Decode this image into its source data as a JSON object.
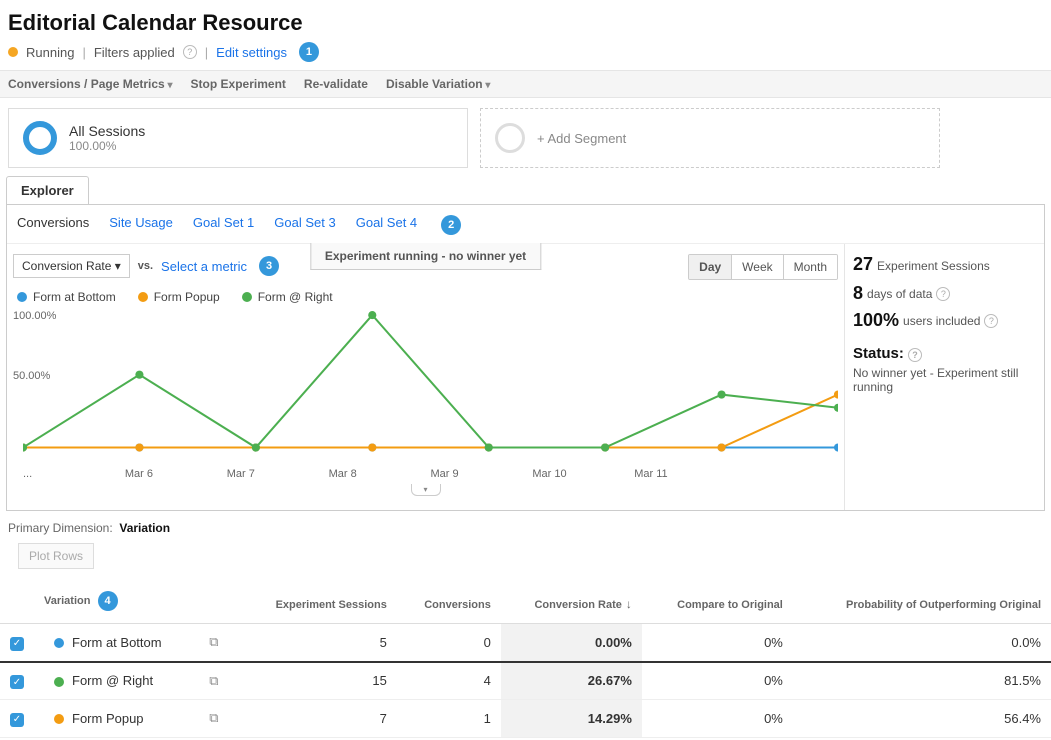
{
  "page_title": "Editorial Calendar Resource",
  "status": {
    "label": "Running",
    "color": "#f5a623"
  },
  "filters_applied": "Filters applied",
  "edit_settings": "Edit settings",
  "toolbar": {
    "metrics": "Conversions / Page Metrics",
    "stop": "Stop Experiment",
    "revalidate": "Re-validate",
    "disable": "Disable Variation"
  },
  "segments": {
    "all": {
      "title": "All Sessions",
      "sub": "100.00%"
    },
    "add": "+ Add Segment"
  },
  "explorer_tab": "Explorer",
  "sub_tabs": [
    "Conversions",
    "Site Usage",
    "Goal Set 1",
    "Goal Set 3",
    "Goal Set 4"
  ],
  "metric_select": "Conversion Rate",
  "vs": "vs.",
  "select_metric": "Select a metric",
  "banner": "Experiment running - no winner yet",
  "granularity": [
    "Day",
    "Week",
    "Month"
  ],
  "granularity_active": "Day",
  "legend": [
    {
      "label": "Form at Bottom",
      "color": "#3498db"
    },
    {
      "label": "Form Popup",
      "color": "#f39c12"
    },
    {
      "label": "Form @ Right",
      "color": "#4caf50"
    }
  ],
  "side": {
    "sessions_n": "27",
    "sessions_l": "Experiment Sessions",
    "days_n": "8",
    "days_l": "days of data",
    "users_n": "100%",
    "users_l": "users included",
    "status_h": "Status:",
    "status_t": "No winner yet - Experiment still running"
  },
  "primary_dim_label": "Primary Dimension:",
  "primary_dim_value": "Variation",
  "plot_rows": "Plot Rows",
  "table": {
    "headers": [
      "Variation",
      "Experiment Sessions",
      "Conversions",
      "Conversion Rate",
      "Compare to Original",
      "Probability of Outperforming Original"
    ],
    "rows": [
      {
        "color": "#3498db",
        "name": "Form at Bottom",
        "sessions": "5",
        "conversions": "0",
        "rate": "0.00%",
        "compare": "0%",
        "prob": "0.0%"
      },
      {
        "color": "#4caf50",
        "name": "Form @ Right",
        "sessions": "15",
        "conversions": "4",
        "rate": "26.67%",
        "compare": "0%",
        "prob": "81.5%"
      },
      {
        "color": "#f39c12",
        "name": "Form Popup",
        "sessions": "7",
        "conversions": "1",
        "rate": "14.29%",
        "compare": "0%",
        "prob": "56.4%"
      }
    ]
  },
  "chart_data": {
    "type": "line",
    "xlabel": "",
    "ylabel": "",
    "ylim": [
      0,
      100
    ],
    "y_ticks": [
      "100.00%",
      "50.00%"
    ],
    "categories": [
      "...",
      "Mar 6",
      "Mar 7",
      "Mar 8",
      "Mar 9",
      "Mar 10",
      "Mar 11",
      ""
    ],
    "series": [
      {
        "name": "Form at Bottom",
        "color": "#3498db",
        "values": [
          0,
          0,
          0,
          0,
          0,
          0,
          0,
          0
        ]
      },
      {
        "name": "Form Popup",
        "color": "#f39c12",
        "values": [
          0,
          0,
          0,
          0,
          0,
          0,
          0,
          40
        ]
      },
      {
        "name": "Form @ Right",
        "color": "#4caf50",
        "values": [
          0,
          55,
          0,
          100,
          0,
          0,
          40,
          30
        ]
      }
    ]
  },
  "annotations": {
    "1": "1",
    "2": "2",
    "3": "3",
    "4": "4"
  }
}
